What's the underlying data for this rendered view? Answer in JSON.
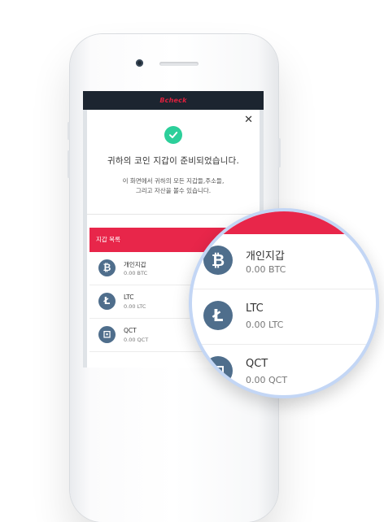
{
  "app": {
    "brand": "Bcheck"
  },
  "modal": {
    "close_glyph": "✕",
    "title": "귀하의 코인 지갑이 준비되었습니다.",
    "subtitle_line1": "이 화면에서 귀하의 모든 지갑들,주소들,",
    "subtitle_line2": "그리고 자산을 볼수 있습니다."
  },
  "wallet_list": {
    "header": "지갑 목록",
    "items": [
      {
        "name": "개인지갑",
        "balance": "0.00 BTC",
        "icon": "bitcoin-icon",
        "glyph": "₿"
      },
      {
        "name": "LTC",
        "balance": "0.00 LTC",
        "icon": "litecoin-icon",
        "glyph": "Ł"
      },
      {
        "name": "QCT",
        "balance": "0.00 QCT",
        "icon": "qct-icon",
        "glyph": "⊡"
      }
    ]
  },
  "colors": {
    "accent": "#e8264a",
    "header_bg": "#1c2530",
    "success": "#2ccf9a",
    "coin_icon": "#4f6e8c",
    "magnifier_ring": "#c3d6f5"
  }
}
